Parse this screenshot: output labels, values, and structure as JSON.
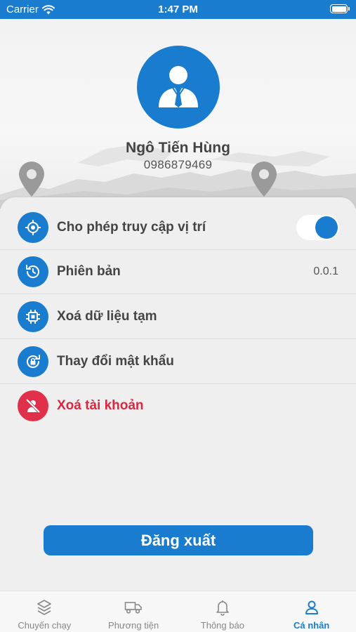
{
  "status_bar": {
    "carrier": "Carrier",
    "time": "1:47 PM",
    "wifi_icon": "wifi-icon",
    "battery_level": 1.0
  },
  "profile": {
    "name": "Ngô Tiến Hùng",
    "phone": "0986879469",
    "avatar_icon": "user-tie-icon"
  },
  "settings": [
    {
      "label": "Cho phép truy cập vị trí",
      "icon": "location-target-icon",
      "control": "toggle",
      "toggle_on": true
    },
    {
      "label": "Phiên bản",
      "icon": "clock-history-icon",
      "value": "0.0.1"
    },
    {
      "label": "Xoá dữ liệu tạm",
      "icon": "chip-icon"
    },
    {
      "label": "Thay đổi mật khẩu",
      "icon": "lock-refresh-icon"
    },
    {
      "label": "Xoá tài khoản",
      "icon": "user-slash-icon",
      "danger": true
    }
  ],
  "logout_label": "Đăng xuất",
  "tabs": [
    {
      "label": "Chuyến chạy",
      "icon": "layers-icon",
      "active": false
    },
    {
      "label": "Phương tiện",
      "icon": "truck-icon",
      "active": false
    },
    {
      "label": "Thông báo",
      "icon": "bell-icon",
      "active": false
    },
    {
      "label": "Cá nhân",
      "icon": "person-icon",
      "active": true
    }
  ],
  "colors": {
    "primary": "#1a7ccf",
    "danger": "#e0304a",
    "background": "#efefef"
  }
}
